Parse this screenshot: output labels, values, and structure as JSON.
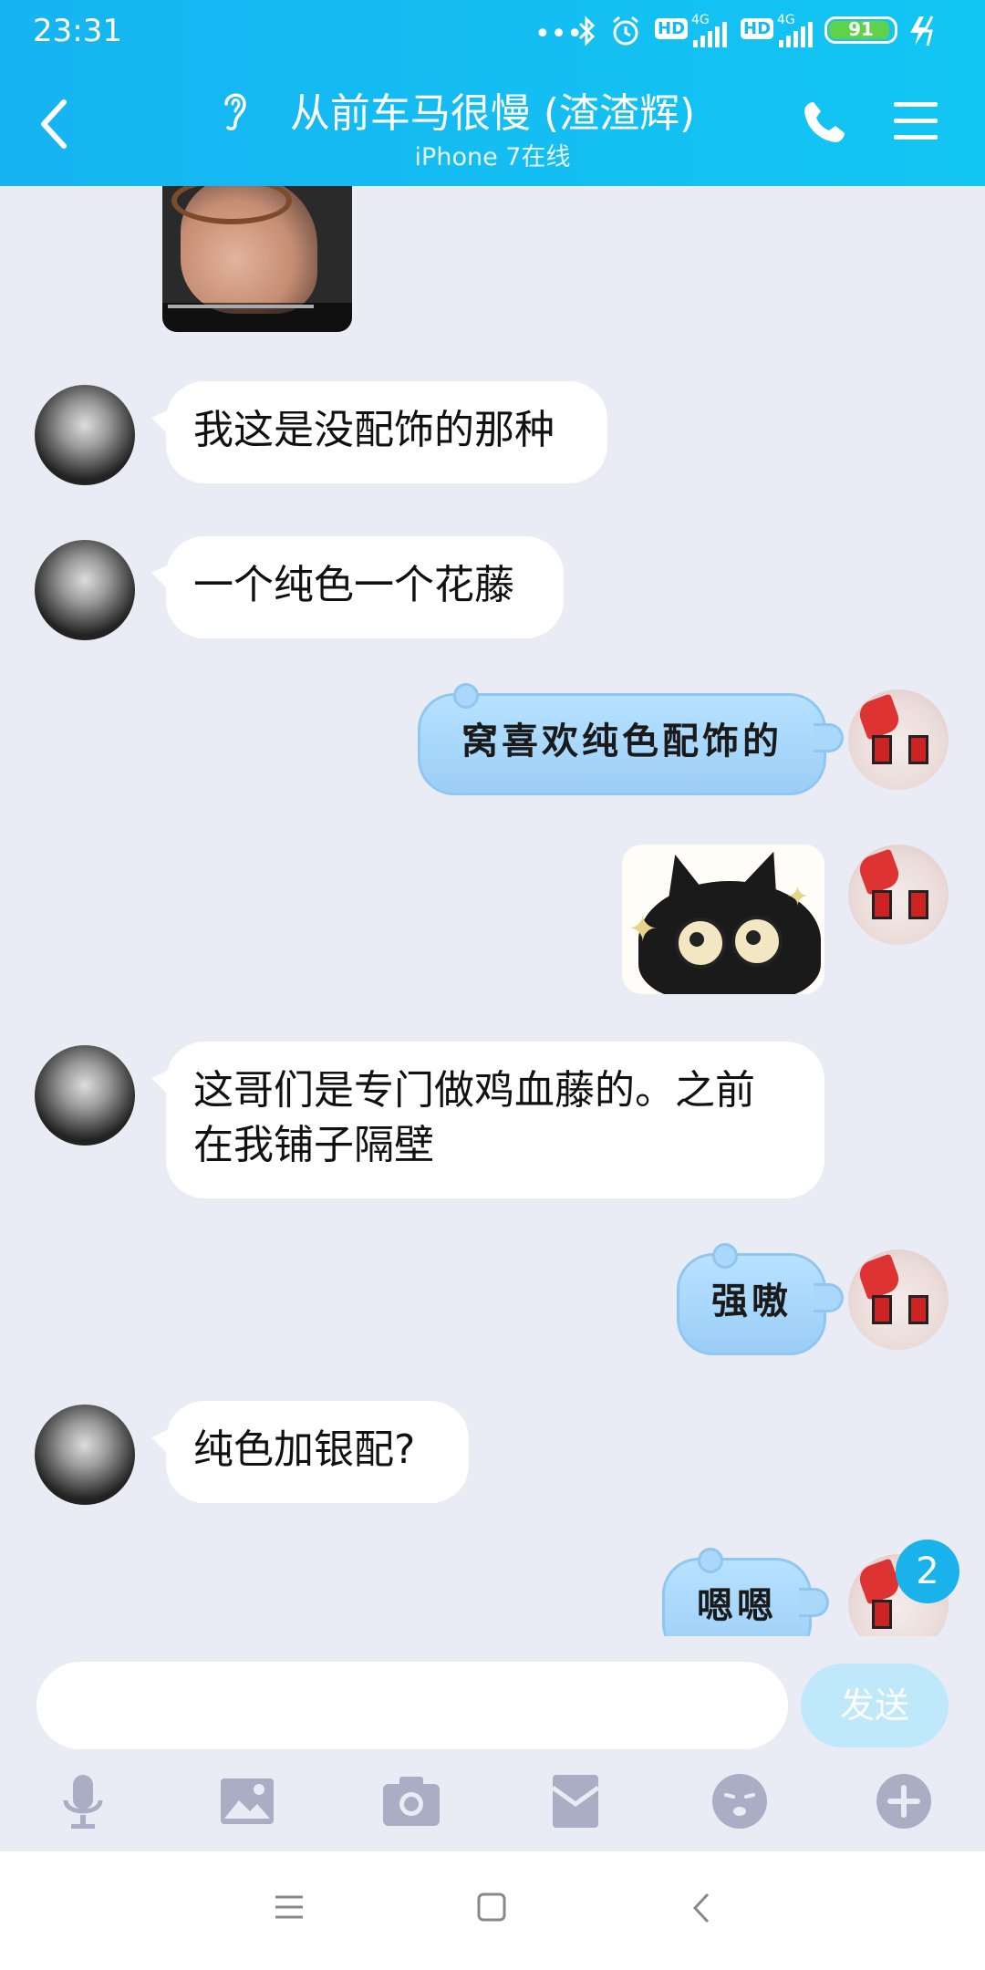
{
  "status_bar": {
    "time": "23:31",
    "hd1": "HD",
    "hd2": "HD",
    "net1": "4G",
    "net2": "4G",
    "battery": "91"
  },
  "header": {
    "title": "从前车马很慢 (渣渣辉)",
    "subtitle": "iPhone 7在线"
  },
  "messages": {
    "m1": "我这是没配饰的那种",
    "m2": "一个纯色一个花藤",
    "m3": "窝喜欢纯色配饰的",
    "m5a": "这哥们是专门做鸡血藤的。之前",
    "m5b": "在我铺子隔壁",
    "m6": "强嗷",
    "m7": "纯色加银配?",
    "m8": "嗯嗯"
  },
  "badge": "2",
  "input": {
    "placeholder": "",
    "send_label": "发送"
  },
  "colors": {
    "header_start": "#16b4f1",
    "header_end": "#12c6f3",
    "chat_bg": "#e9ecf4",
    "bubble_blue": "#a6d6fb",
    "send_disabled": "#bfe9fb",
    "badge": "#19b2ea"
  },
  "icons": {
    "back": "chevron-left-icon",
    "ear": "ear-icon",
    "call": "phone-icon",
    "menu": "hamburger-menu-icon",
    "mic": "microphone-icon",
    "image": "image-icon",
    "camera": "camera-icon",
    "red_packet": "red-envelope-icon",
    "emoji": "emoji-icon",
    "plus": "plus-circle-icon"
  }
}
